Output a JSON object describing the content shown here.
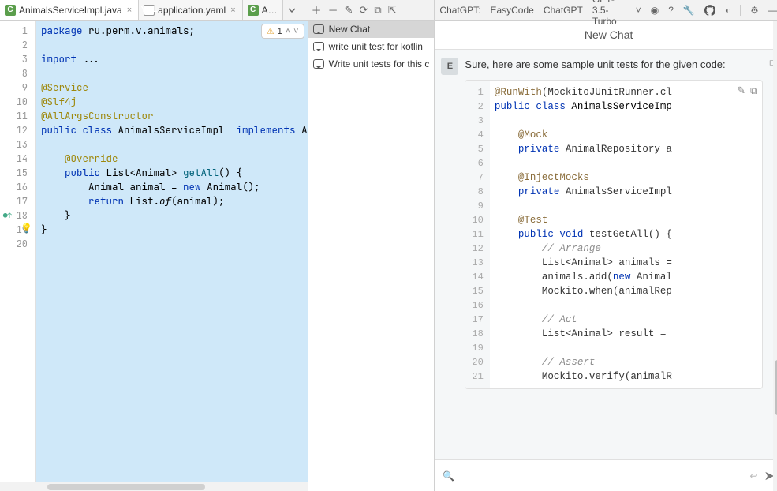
{
  "tabs": {
    "file1": "AnimalsServiceImpl.java",
    "file2": "application.yaml",
    "file3": "A…"
  },
  "inspections": {
    "warnings": "1"
  },
  "gutterLines": [
    "1",
    "2",
    "3",
    "8",
    "9",
    "10",
    "11",
    "12",
    "13",
    "14",
    "15",
    "16",
    "17",
    "18",
    "19",
    "20"
  ],
  "code": {
    "l1a": "package",
    "l1b": " ru.perm.v.animals;",
    "l3a": "import",
    "l3b": " ...",
    "l5": "@Service",
    "l6": "@Slf4j",
    "l7": "@AllArgsConstructor",
    "l8a": "public ",
    "l8b": "class ",
    "l8c": "AnimalsServiceImpl ",
    "l8d": " implements ",
    "l8e": "A",
    "l10": "    @Override",
    "l11a": "    public ",
    "l11b": "List<Animal> ",
    "l11c": "getAll",
    "l11d": "() {",
    "l12a": "        Animal ",
    "l12b": "animal",
    "l12c": " = ",
    "l12d": "new ",
    "l12e": "Animal();",
    "l13a": "        return ",
    "l13b": "List.",
    "l13c": "of",
    "l13d": "(animal);",
    "l14": "    }",
    "l15": "}"
  },
  "history": {
    "h1": "New Chat",
    "h2": "write unit test for kotlin",
    "h3": "Write unit tests for this c"
  },
  "rightTop": {
    "brand": "ChatGPT:",
    "easy": "EasyCode",
    "chatgpt": "ChatGPT",
    "model": "GPT-3.5-Turbo"
  },
  "rightTitle": "New Chat",
  "chat": {
    "intro": "Sure, here are some sample unit tests for the given code:",
    "cbLines": [
      "1",
      "2",
      "3",
      "4",
      "5",
      "6",
      "7",
      "8",
      "9",
      "10",
      "11",
      "12",
      "13",
      "14",
      "15",
      "16",
      "17",
      "18",
      "19",
      "20",
      "21"
    ],
    "cb": {
      "l1a": "@RunWith",
      "l1b": "(MockitoJUnitRunner.",
      "l1c": "cl",
      "l2a": "public ",
      "l2b": "class ",
      "l2c": "AnimalsServiceImp",
      "l4": "    @Mock",
      "l5a": "    private ",
      "l5b": "AnimalRepository a",
      "l7": "    @InjectMocks",
      "l8a": "    private ",
      "l8b": "AnimalsServiceImpl",
      "l10": "    @Test",
      "l11a": "    public ",
      "l11b": "void ",
      "l11c": "testGetAll() {",
      "l12": "        // Arrange",
      "l13": "        List<Animal> animals =",
      "l14a": "        animals.add(",
      "l14b": "new ",
      "l14c": "Animal",
      "l15": "        Mockito.when(animalRep",
      "l17": "        // Act",
      "l18": "        List<Animal> result =",
      "l20": "        // Assert",
      "l21": "        Mockito.verify(animalR"
    }
  }
}
